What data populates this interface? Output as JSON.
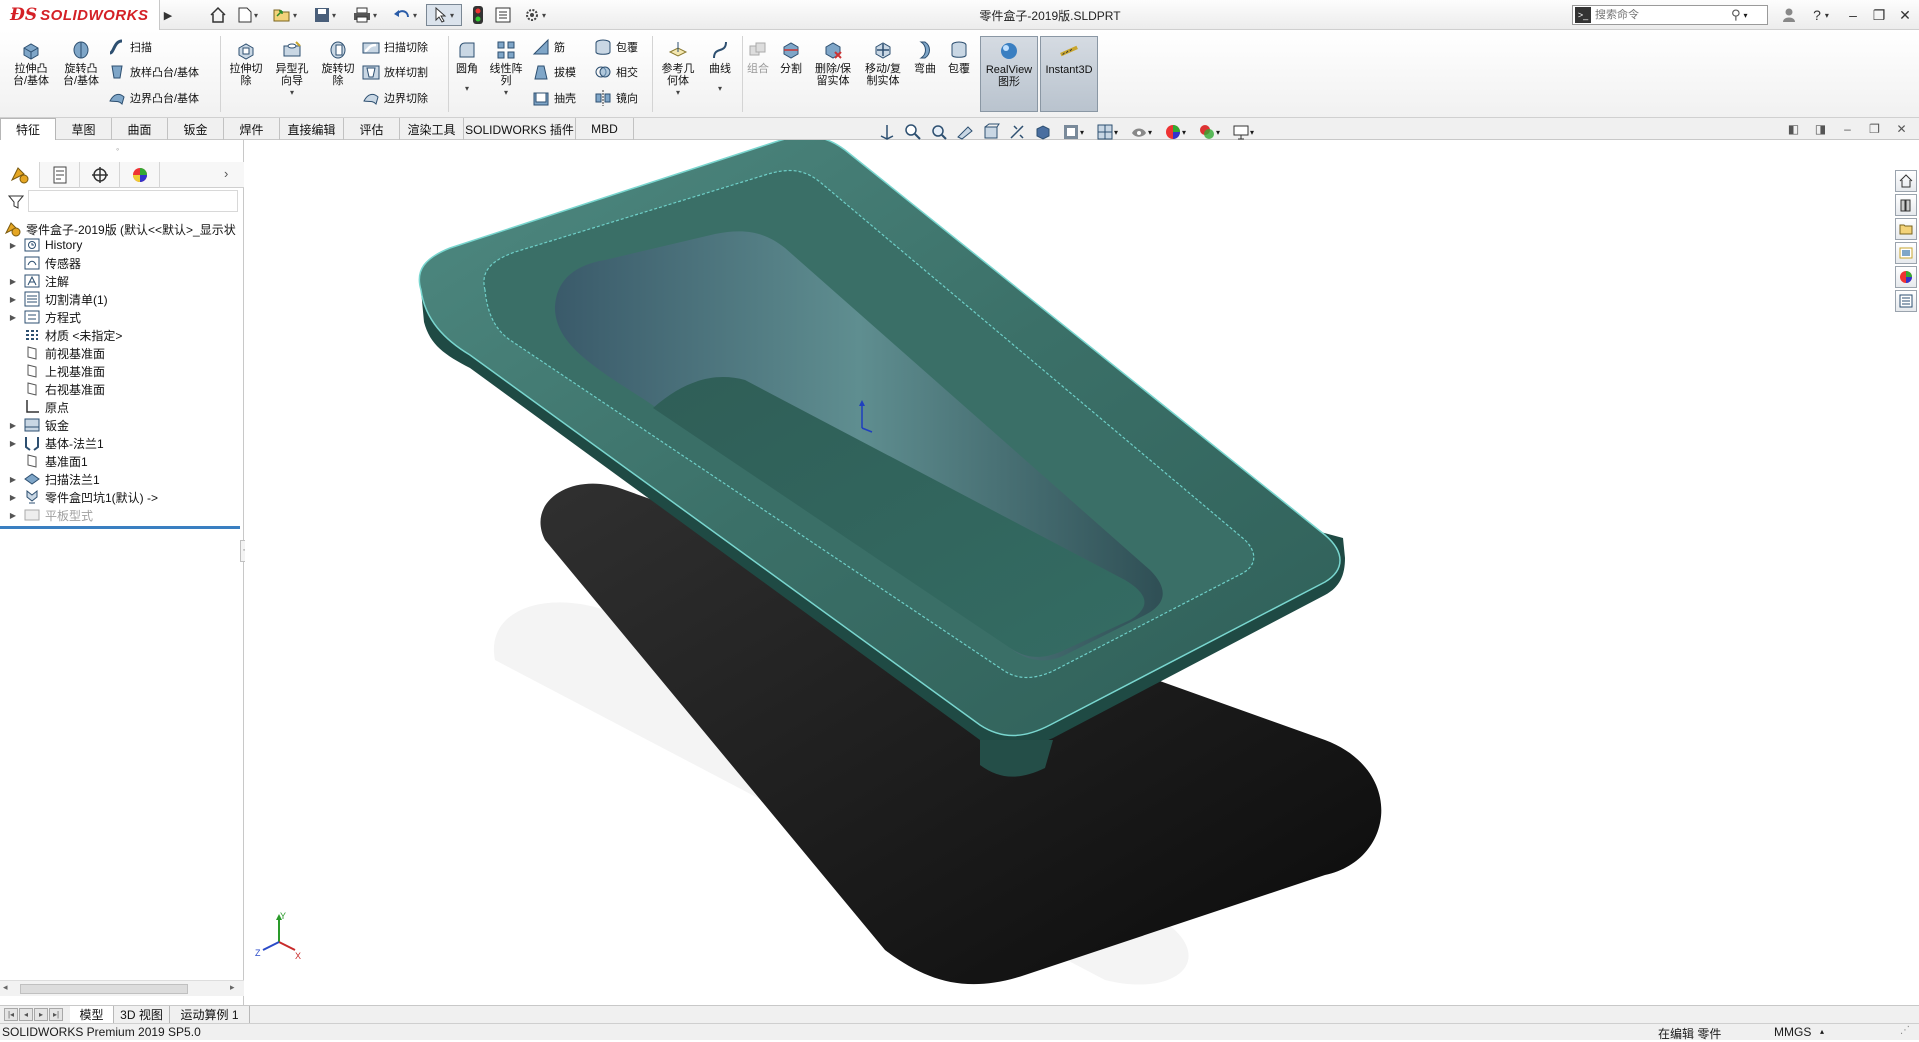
{
  "app": {
    "logo_text": "SOLIDWORKS",
    "document_title": "零件盒子-2019版.SLDPRT",
    "search_placeholder": "搜索命令"
  },
  "command_manager": {
    "extrude_boss": "拉伸凸\n台/基体",
    "revolve_boss": "旋转凸\n台/基体",
    "sweep": "扫描",
    "loft_boss": "放样凸台/基体",
    "boundary_boss": "边界凸台/基体",
    "extrude_cut": "拉伸切\n除",
    "hole_wizard": "异型孔\n向导",
    "revolve_cut": "旋转切\n除",
    "swept_cut": "扫描切除",
    "lofted_cut": "放样切割",
    "boundary_cut": "边界切除",
    "fillet": "圆角",
    "linear_pattern": "线性阵\n列",
    "rib": "筋",
    "draft": "拔模",
    "shell": "抽壳",
    "wrap": "包覆",
    "intersect": "相交",
    "mirror": "镜向",
    "ref_geometry": "参考几\n何体",
    "curves": "曲线",
    "combine": "组合",
    "split": "分割",
    "delete_keep_body": "删除/保\n留实体",
    "move_copy_body": "移动/复\n制实体",
    "flex": "弯曲",
    "wrap2": "包覆",
    "realview": "RealView\n图形",
    "instant3d": "Instant3D"
  },
  "tabs": [
    "特征",
    "草图",
    "曲面",
    "钣金",
    "焊件",
    "直接编辑",
    "评估",
    "渲染工具",
    "SOLIDWORKS 插件",
    "MBD"
  ],
  "feature_tree": {
    "root": "零件盒子-2019版 (默认<<默认>_显示状",
    "items": [
      {
        "label": "History",
        "icon": "history-icon",
        "expandable": true
      },
      {
        "label": "传感器",
        "icon": "sensor-icon",
        "expandable": false
      },
      {
        "label": "注解",
        "icon": "annotation-icon",
        "expandable": true
      },
      {
        "label": "切割清单(1)",
        "icon": "cutlist-icon",
        "expandable": true
      },
      {
        "label": "方程式",
        "icon": "equation-icon",
        "expandable": true
      },
      {
        "label": "材质 <未指定>",
        "icon": "material-icon",
        "expandable": false
      },
      {
        "label": "前视基准面",
        "icon": "plane-icon",
        "expandable": false
      },
      {
        "label": "上视基准面",
        "icon": "plane-icon",
        "expandable": false
      },
      {
        "label": "右视基准面",
        "icon": "plane-icon",
        "expandable": false
      },
      {
        "label": "原点",
        "icon": "origin-icon",
        "expandable": false
      },
      {
        "label": "钣金",
        "icon": "sheetmetal-icon",
        "expandable": true
      },
      {
        "label": "基体-法兰1",
        "icon": "base-flange-icon",
        "expandable": true
      },
      {
        "label": "基准面1",
        "icon": "plane-icon",
        "expandable": false
      },
      {
        "label": "扫描法兰1",
        "icon": "swept-flange-icon",
        "expandable": true
      },
      {
        "label": "零件盒凹坑1(默认) ->",
        "icon": "forming-tool-icon",
        "expandable": true
      },
      {
        "label": "平板型式",
        "icon": "flat-pattern-icon",
        "expandable": true
      }
    ]
  },
  "bottom_tabs": [
    "模型",
    "3D 视图",
    "运动算例 1"
  ],
  "status": {
    "product": "SOLIDWORKS Premium 2019 SP5.0",
    "mode": "在编辑 零件",
    "units": "MMGS"
  },
  "colors": {
    "brand_red": "#d42026",
    "part_teal": "#3f7a72",
    "selection_blue": "#3a7fc1"
  }
}
